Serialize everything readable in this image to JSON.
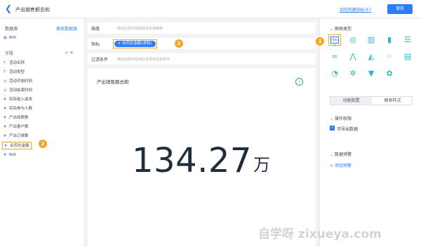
{
  "header": {
    "back_glyph": "❮",
    "title": "产出销售额总和",
    "help_link": "如何构建指标卡?",
    "save_label": "保存"
  },
  "left": {
    "dataset_title": "数据源",
    "switch_dataset": "更改数据源",
    "dataset_item": "ROI",
    "fields_title": "字段",
    "fields": [
      {
        "icon": "T",
        "name": "活动名称"
      },
      {
        "icon": "T",
        "name": "活动类型"
      },
      {
        "icon": "◷",
        "name": "活动开始时间"
      },
      {
        "icon": "◷",
        "name": "活动结束时间"
      },
      {
        "icon": "#",
        "name": "实际投入成本"
      },
      {
        "icon": "#",
        "name": "实际参与人数"
      },
      {
        "icon": "#",
        "name": "产出线索数"
      },
      {
        "icon": "#",
        "name": "产出客户数"
      },
      {
        "icon": "#",
        "name": "产出订单数"
      },
      {
        "icon": "#",
        "name": "合同总金额"
      },
      {
        "icon": "#",
        "name": "ROI"
      }
    ]
  },
  "badges": {
    "one": "1",
    "two": "2"
  },
  "query": {
    "dimension_label": "维度",
    "dimension_placeholder": "拖动左侧字段到此处添加维度",
    "metric_label": "指标",
    "metric_chip": "∨ 合同总金额(求和)",
    "filter_label": "过滤条件",
    "filter_placeholder": "拖动左侧字段到此处添加过滤条件"
  },
  "card": {
    "title": "产出销售额总和",
    "info_glyph": "i",
    "value": "134.27",
    "unit": "万"
  },
  "right": {
    "chart_type_title": "图表类型",
    "selected_type_label": "指标卡",
    "chart_types": [
      "◎",
      "▥",
      "▮",
      "☰",
      "≈",
      "⋀",
      "◭",
      "⁘",
      "▤",
      "◔",
      "✲",
      "▼",
      "✿"
    ],
    "tabs": [
      "功能配置",
      "图表样式"
    ],
    "permission_title": "操作权限",
    "export_label": "可导出数据",
    "alert_title": "数据预警",
    "add_alert": "+ 添加预警"
  },
  "watermark": "自学呀 zixueya.com"
}
